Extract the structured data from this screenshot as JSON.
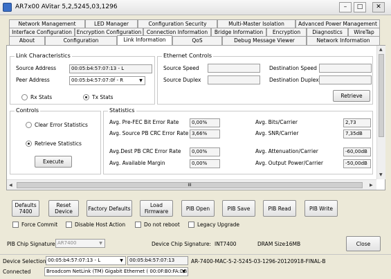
{
  "window": {
    "title": "AR7x00 AVitar 5,2,5245,03,1296",
    "minimize": "–",
    "maximize": "□",
    "close": "✕"
  },
  "tabs": {
    "row1": [
      "Network Management",
      "LED Manager",
      "Configuration Security",
      "Multi-Master Isolation",
      "Advanced Power Management"
    ],
    "row2": [
      "Interface Configuration",
      "Encryption Configuration",
      "Connection Information",
      "Bridge Information",
      "Encryption",
      "Diagnostics",
      "WireTap"
    ],
    "row3": [
      "About",
      "Configuration",
      "Link Information",
      "QoS",
      "Debug Message Viewer",
      "Network Information"
    ]
  },
  "link": {
    "title": "Link Characteristics",
    "source_label": "Source Address",
    "source_value": "00:05:b4:57:07:13 - L",
    "peer_label": "Peer Address",
    "peer_value": "00:05:b4:57:07:0f - R",
    "rx_label": "Rx Stats",
    "tx_label": "Tx Stats",
    "selected": "tx"
  },
  "ethernet": {
    "title": "Ethernet Controls",
    "source_speed": "Source Speed",
    "source_duplex": "Source Duplex",
    "dest_speed": "Destination Speed",
    "dest_duplex": "Destination Duplex",
    "retrieve": "Retrieve"
  },
  "controls": {
    "title": "Controls",
    "clear_label": "Clear Error Statistics",
    "retrieve_label": "Retrieve Statistics",
    "selected": "retrieve",
    "execute": "Execute"
  },
  "stats": {
    "title": "Statistics",
    "pre_fec_label": "Avg. Pre-FEC Bit Error Rate",
    "pre_fec_value": "0,00%",
    "src_pb_label": "Avg. Source PB CRC Error Rate",
    "src_pb_value": "3,66%",
    "dest_pb_label": "Avg.Dest PB CRC Error Rate",
    "dest_pb_value": "0,00%",
    "margin_label": "Avg. Available Margin",
    "margin_value": "0,00%",
    "bits_label": "Avg. Bits/Carrier",
    "bits_value": "2,73",
    "snr_label": "Avg. SNR/Carrier",
    "snr_value": "7,35dB",
    "atten_label": "Avg. Attenuation/Carrier",
    "atten_value": "-60,00dB",
    "power_label": "Avg. Output Power/Carrier",
    "power_value": "-50,00dB"
  },
  "scroll": {
    "grip": "III",
    "up": "▲",
    "down": "▼",
    "left": "◀",
    "right": "▶"
  },
  "actions": {
    "defaults_7400": "Defaults 7400",
    "reset": "Reset Device",
    "factory": "Factory Defaults",
    "load": "Load Firmware",
    "pib_open": "PIB Open",
    "pib_save": "PIB Save",
    "pib_read": "PIB Read",
    "pib_write": "PIB Write"
  },
  "options": {
    "force_commit": "Force Commit",
    "disable_host": "Disable Host Action",
    "no_reboot": "Do not reboot",
    "legacy": "Legacy Upgrade"
  },
  "chip": {
    "pib_label": "PIB Chip Signature:",
    "pib_value": "AR7400",
    "device_label": "Device Chip Signature:",
    "device_value": "INT7400",
    "dram_label": "DRAM Size:",
    "dram_value": "16MB",
    "close": "Close"
  },
  "device": {
    "label": "Device Selection:",
    "selected": "00:05:b4:57:07:13 - L",
    "mac": "00:05:b4:57:07:13",
    "firmware": "AR-7400-MAC-5-2-5245-03-1296-20120918-FINAL-B"
  },
  "status": {
    "connected": "Connected",
    "adapter": "Broadcom NetLink (TM) Gigabit Ethernet  ( 00:0F:B0:FA:DB"
  }
}
